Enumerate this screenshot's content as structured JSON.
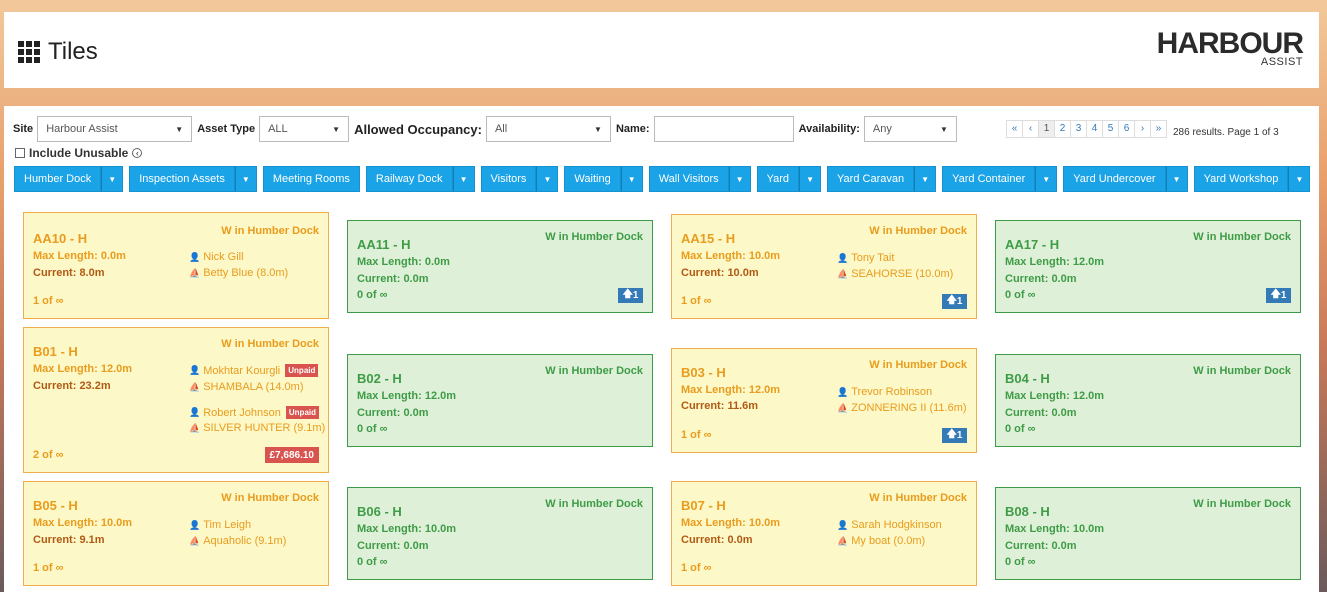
{
  "header": {
    "title": "Tiles",
    "logo_main": "HARBOUR",
    "logo_sub": "ASSIST"
  },
  "filters": {
    "site_label": "Site",
    "site_value": "Harbour Assist",
    "asset_type_label": "Asset Type",
    "asset_type_value": "ALL",
    "occupancy_label": "Allowed Occupancy:",
    "occupancy_value": "All",
    "name_label": "Name:",
    "name_value": "",
    "availability_label": "Availability:",
    "availability_value": "Any",
    "include_unusable_label": "Include Unusable"
  },
  "pager": {
    "first": "«",
    "prev": "‹",
    "pages": [
      "1",
      "2",
      "3",
      "4",
      "5",
      "6"
    ],
    "next": "›",
    "last": "»",
    "info": "286 results. Page 1 of 3"
  },
  "buttons": [
    "Humber Dock",
    "Inspection Assets",
    "Meeting Rooms",
    "Railway Dock",
    "Visitors",
    "Waiting",
    "Wall Visitors",
    "Yard",
    "Yard Caravan",
    "Yard Container",
    "Yard Undercover",
    "Yard Workshop"
  ],
  "tiles": {
    "aa10": {
      "name": "AA10 - H",
      "loc": "W in Humber Dock",
      "max": "Max Length: 0.0m",
      "cur": "Current: 8.0m",
      "count": "1 of ∞",
      "person": "Nick Gill",
      "boat": "Betty Blue (8.0m)"
    },
    "aa11": {
      "name": "AA11 - H",
      "loc": "W in Humber Dock",
      "max": "Max Length: 0.0m",
      "cur": "Current: 0.0m",
      "count": "0 of ∞",
      "badge": "1"
    },
    "aa15": {
      "name": "AA15 - H",
      "loc": "W in Humber Dock",
      "max": "Max Length: 10.0m",
      "cur": "Current: 10.0m",
      "count": "1 of ∞",
      "person": "Tony Tait",
      "boat": "SEAHORSE (10.0m)",
      "badge": "1"
    },
    "aa17": {
      "name": "AA17 - H",
      "loc": "W in Humber Dock",
      "max": "Max Length: 12.0m",
      "cur": "Current: 0.0m",
      "count": "0 of ∞",
      "badge": "1"
    },
    "b01": {
      "name": "B01 - H",
      "loc": "W in Humber Dock",
      "max": "Max Length: 12.0m",
      "cur": "Current: 23.2m",
      "count": "2 of ∞",
      "person": "Mokhtar Kourgli",
      "boat": "SHAMBALA (14.0m)",
      "person2": "Robert Johnson",
      "boat2": "SILVER HUNTER (9.1m)",
      "unpaid": "Unpaid",
      "amount": "£7,686.10"
    },
    "b02": {
      "name": "B02 - H",
      "loc": "W in Humber Dock",
      "max": "Max Length: 12.0m",
      "cur": "Current: 0.0m",
      "count": "0 of ∞"
    },
    "b03": {
      "name": "B03 - H",
      "loc": "W in Humber Dock",
      "max": "Max Length: 12.0m",
      "cur": "Current: 11.6m",
      "count": "1 of ∞",
      "person": "Trevor Robinson",
      "boat": "ZONNERING II (11.6m)",
      "badge": "1"
    },
    "b04": {
      "name": "B04 - H",
      "loc": "W in Humber Dock",
      "max": "Max Length: 12.0m",
      "cur": "Current: 0.0m",
      "count": "0 of ∞"
    },
    "b05": {
      "name": "B05 - H",
      "loc": "W in Humber Dock",
      "max": "Max Length: 10.0m",
      "cur": "Current: 9.1m",
      "count": "1 of ∞",
      "person": "Tim Leigh",
      "boat": "Aquaholic (9.1m)"
    },
    "b06": {
      "name": "B06 - H",
      "loc": "W in Humber Dock",
      "max": "Max Length: 10.0m",
      "cur": "Current: 0.0m",
      "count": "0 of ∞"
    },
    "b07": {
      "name": "B07 - H",
      "loc": "W in Humber Dock",
      "max": "Max Length: 10.0m",
      "cur": "Current: 0.0m",
      "count": "1 of ∞",
      "person": "Sarah Hodgkinson",
      "boat": "My boat (0.0m)"
    },
    "b08": {
      "name": "B08 - H",
      "loc": "W in Humber Dock",
      "max": "Max Length: 10.0m",
      "cur": "Current: 0.0m",
      "count": "0 of ∞"
    }
  },
  "colors": {
    "accent": "#1aa3e6",
    "occupied": "#fcf8c8",
    "free": "#dff0d8",
    "badge": "#337ab7",
    "danger": "#d9534f"
  },
  "icons": {
    "grid": "grid-icon",
    "person": "user-icon",
    "boat": "boat-icon",
    "up": "arrow-up-icon"
  }
}
